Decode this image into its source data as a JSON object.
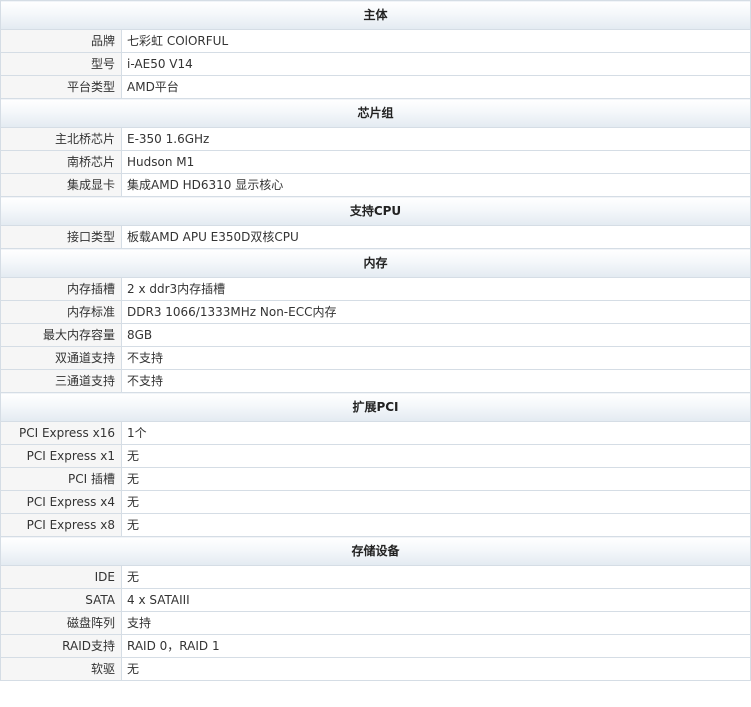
{
  "sections": [
    {
      "title": "主体",
      "rows": [
        {
          "label": "品牌",
          "value": "七彩虹 COlORFUL"
        },
        {
          "label": "型号",
          "value": "i-AE50 V14"
        },
        {
          "label": "平台类型",
          "value": "AMD平台"
        }
      ]
    },
    {
      "title": "芯片组",
      "rows": [
        {
          "label": "主北桥芯片",
          "value": "E-350 1.6GHz"
        },
        {
          "label": "南桥芯片",
          "value": "Hudson M1"
        },
        {
          "label": "集成显卡",
          "value": "集成AMD HD6310 显示核心"
        }
      ]
    },
    {
      "title": "支持CPU",
      "rows": [
        {
          "label": "接口类型",
          "value": "板载AMD APU E350D双核CPU"
        }
      ]
    },
    {
      "title": "内存",
      "rows": [
        {
          "label": "内存插槽",
          "value": "2 x ddr3内存插槽"
        },
        {
          "label": "内存标准",
          "value": "DDR3 1066/1333MHz Non-ECC内存"
        },
        {
          "label": "最大内存容量",
          "value": "8GB"
        },
        {
          "label": "双通道支持",
          "value": "不支持"
        },
        {
          "label": "三通道支持",
          "value": "不支持"
        }
      ]
    },
    {
      "title": "扩展PCI",
      "rows": [
        {
          "label": "PCI Express x16",
          "value": "1个"
        },
        {
          "label": "PCI Express x1",
          "value": "无"
        },
        {
          "label": "PCI 插槽",
          "value": "无"
        },
        {
          "label": "PCI Express x4",
          "value": "无"
        },
        {
          "label": "PCI Express x8",
          "value": "无"
        }
      ]
    },
    {
      "title": "存储设备",
      "rows": [
        {
          "label": "IDE",
          "value": "无"
        },
        {
          "label": "SATA",
          "value": "4 x SATAIII"
        },
        {
          "label": "磁盘阵列",
          "value": "支持"
        },
        {
          "label": "RAID支持",
          "value": "RAID 0，RAID 1"
        },
        {
          "label": "软驱",
          "value": "无"
        }
      ]
    }
  ]
}
